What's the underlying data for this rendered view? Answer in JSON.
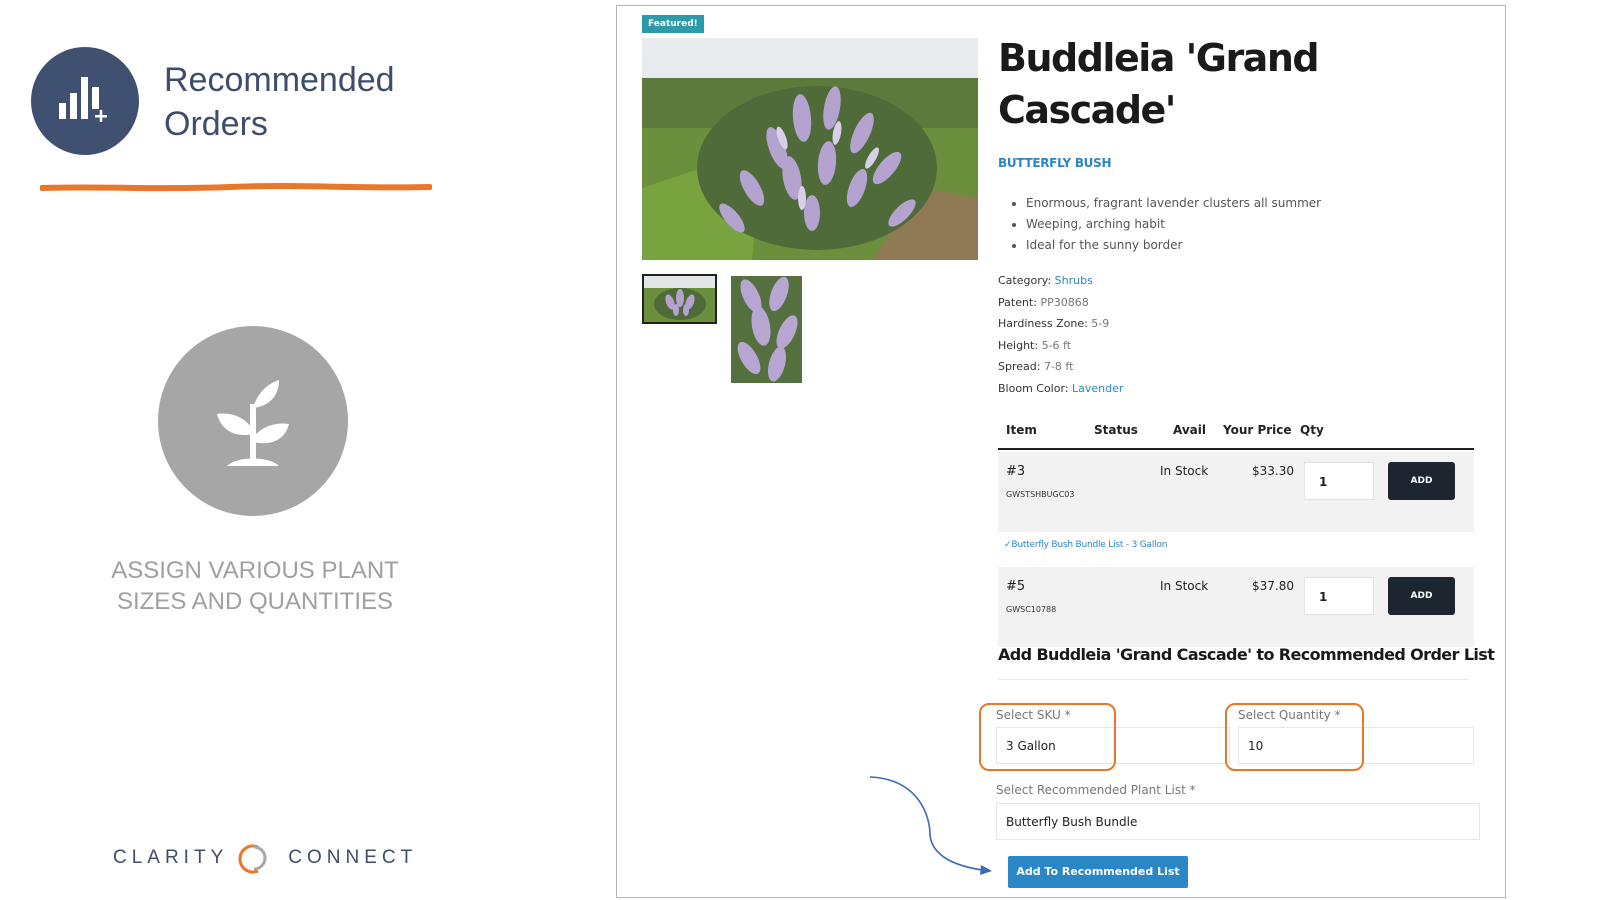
{
  "slide": {
    "title": "Recommended Orders",
    "caption": "ASSIGN VARIOUS PLANT SIZES AND QUANTITIES",
    "logo": {
      "left": "CLARITY",
      "right": "CONNECT"
    },
    "colors": {
      "navy": "#3f5070",
      "orange": "#e8772a",
      "gray": "#a6a6a6"
    }
  },
  "product": {
    "badge": "Featured!",
    "title": "Buddleia 'Grand Cascade'",
    "subtitle": "BUTTERFLY BUSH",
    "bullets": [
      "Enormous, fragrant lavender clusters all summer",
      "Weeping, arching habit",
      "Ideal for the sunny border"
    ],
    "specs": {
      "category": {
        "label": "Category:",
        "value": "Shrubs"
      },
      "patent": {
        "label": "Patent:",
        "value": "PP30868"
      },
      "zone": {
        "label": "Hardiness Zone:",
        "value": "5-9"
      },
      "height": {
        "label": "Height:",
        "value": "5-6 ft"
      },
      "spread": {
        "label": "Spread:",
        "value": "7-8 ft"
      },
      "bloom": {
        "label": "Bloom Color:",
        "value": "Lavender"
      }
    }
  },
  "table": {
    "headers": {
      "item": "Item",
      "status": "Status",
      "avail": "Avail",
      "price": "Your Price",
      "qty": "Qty"
    },
    "rows": [
      {
        "item": "#3",
        "sku": "GWSTSHBUGC03",
        "avail": "In Stock",
        "price": "$33.30",
        "qty": "1",
        "action": "ADD"
      },
      {
        "item": "#5",
        "sku": "GWSC10788",
        "avail": "In Stock",
        "price": "$37.80",
        "qty": "1",
        "action": "ADD"
      }
    ],
    "bundle_note": "Butterfly Bush Bundle List - 3 Gallon"
  },
  "form": {
    "title": "Add Buddleia 'Grand Cascade' to Recommended Order List",
    "sku_label": "Select SKU *",
    "sku_value": "3 Gallon",
    "qty_label": "Select Quantity *",
    "qty_value": "10",
    "list_label": "Select Recommended Plant List *",
    "list_value": "Butterfly Bush Bundle",
    "submit": "Add To Recommended List"
  }
}
